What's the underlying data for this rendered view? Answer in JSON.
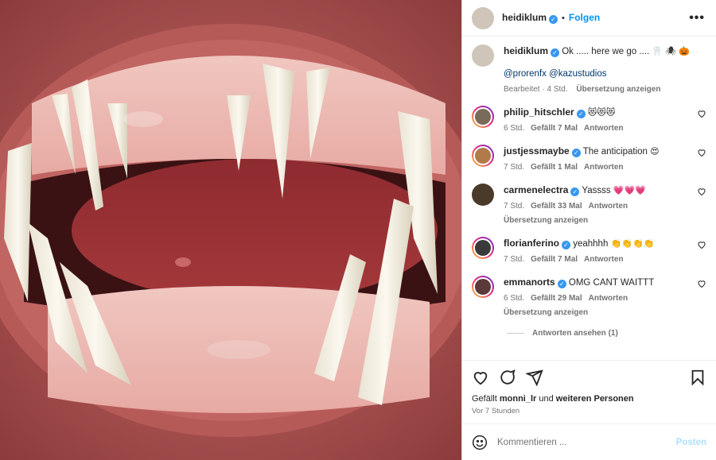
{
  "post": {
    "username": "heidiklum",
    "follow_label": "Folgen",
    "dot": "•",
    "more_label": "•••"
  },
  "caption": {
    "username": "heidiklum",
    "text": "Ok ..... here we go ....",
    "emojis": "🦷 🕷 🎃",
    "mentions": "@prorenfx @kazustudios",
    "edited": "Bearbeitet · 4 Std.",
    "translate": "Übersetzung anzeigen"
  },
  "comments": [
    {
      "username": "philip_hitschler",
      "text": "",
      "emojis": "😻😻😻",
      "time": "6 Std.",
      "likes": "Gefällt 7 Mal",
      "reply": "Antworten",
      "translate": "",
      "avatar_color": "#7a6a5a",
      "ring": true
    },
    {
      "username": "justjessmaybe",
      "text": "The anticipation",
      "emojis": "😍",
      "time": "7 Std.",
      "likes": "Gefällt 1 Mal",
      "reply": "Antworten",
      "translate": "",
      "avatar_color": "#b07a4a",
      "ring": true
    },
    {
      "username": "carmenelectra",
      "text": "Yassss",
      "emojis": "💗💗💗",
      "time": "7 Std.",
      "likes": "Gefällt 33 Mal",
      "reply": "Antworten",
      "translate": "Übersetzung anzeigen",
      "avatar_color": "#4a3a2a",
      "ring": false
    },
    {
      "username": "florianferino",
      "text": "yeahhhh",
      "emojis": "👏👏👏👏",
      "time": "7 Std.",
      "likes": "Gefällt 7 Mal",
      "reply": "Antworten",
      "translate": "",
      "avatar_color": "#3a3a3a",
      "ring": true
    },
    {
      "username": "emmanorts",
      "text": "OMG CANT WAITTT",
      "emojis": "",
      "time": "6 Std.",
      "likes": "Gefällt 29 Mal",
      "reply": "Antworten",
      "translate": "Übersetzung anzeigen",
      "avatar_color": "#5a3a3a",
      "ring": true
    }
  ],
  "replies_label": "Antworten ansehen (1)",
  "likes": {
    "prefix": "Gefällt",
    "user": "monni_lr",
    "middle": "und",
    "others": "weiteren Personen"
  },
  "timestamp": "Vor 7 Stunden",
  "add_comment": {
    "placeholder": "Kommentieren ...",
    "post_label": "Posten"
  },
  "colors": {
    "accent": "#0095f6",
    "verified": "#3897f0",
    "post_disabled": "#b2dffc"
  },
  "icons": [
    "heart-icon",
    "comment-icon",
    "share-icon",
    "bookmark-icon",
    "emoji-icon",
    "more-icon",
    "verified-icon"
  ]
}
